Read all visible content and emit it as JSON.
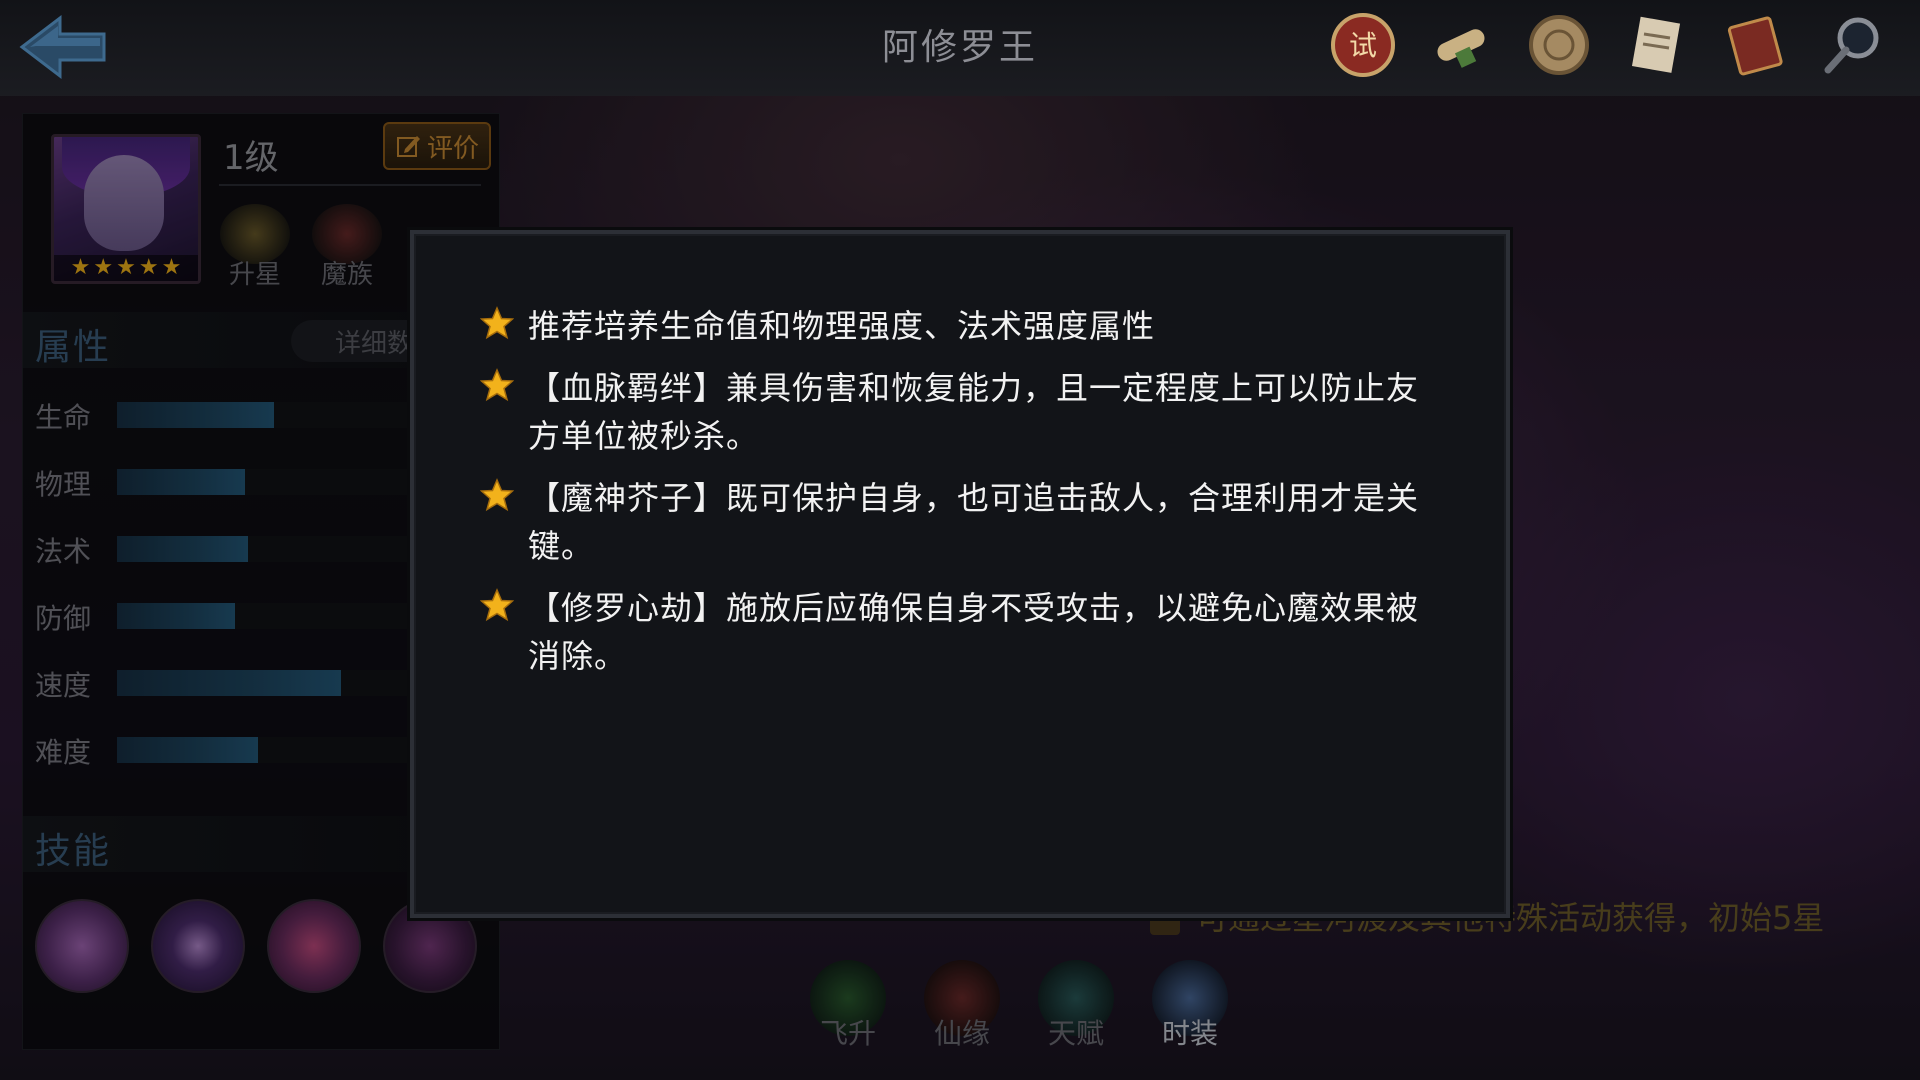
{
  "header": {
    "title": "阿修罗王"
  },
  "top_icons": [
    "trial-seal-icon",
    "scroll-icon",
    "medallion-icon",
    "document-icon",
    "book-icon",
    "magnifier-icon"
  ],
  "hero": {
    "level": "1级",
    "rate_label": "评价",
    "stars": 5,
    "badges": [
      {
        "label": "升星",
        "icon": "star-badge-icon"
      },
      {
        "label": "魔族",
        "icon": "demon-clan-icon"
      }
    ]
  },
  "attributes": {
    "heading": "属性",
    "detail_label": "详细数",
    "stats": [
      {
        "name": "生命",
        "level": 0.49
      },
      {
        "name": "物理",
        "level": 0.4
      },
      {
        "name": "法术",
        "level": 0.41
      },
      {
        "name": "防御",
        "level": 0.37
      },
      {
        "name": "速度",
        "level": 0.7
      },
      {
        "name": "难度",
        "level": 0.44
      }
    ]
  },
  "skills": {
    "heading": "技能"
  },
  "bottom": {
    "hint": "可通过星河渡及其他特殊活动获得，初始5星",
    "nav": [
      {
        "label": "飞升",
        "active": false
      },
      {
        "label": "仙缘",
        "active": false
      },
      {
        "label": "天赋",
        "active": false
      },
      {
        "label": "时装",
        "active": true
      }
    ]
  },
  "tips_modal": {
    "tips": [
      "推荐培养生命值和物理强度、法术强度属性",
      "【血脉羁绊】兼具伤害和恢复能力，且一定程度上可以防止友方单位被秒杀。",
      "【魔神芥子】既可保护自身，也可追击敌人，合理利用才是关键。",
      "【修罗心劫】施放后应确保自身不受攻击，以避免心魔效果被消除。"
    ]
  },
  "colors": {
    "accent_gold": "#f2b21b",
    "stat_bar": "#24597a",
    "section_heading": "#3c5f7d"
  }
}
